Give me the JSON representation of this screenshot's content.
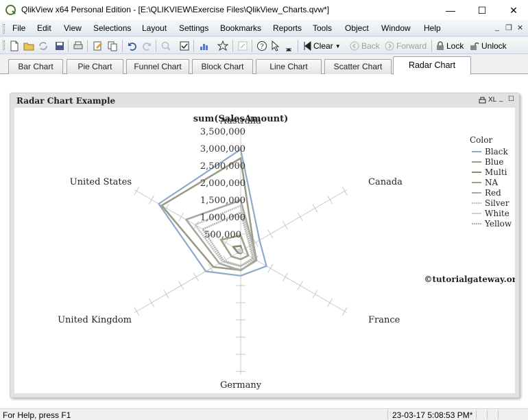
{
  "window": {
    "title": "QlikView x64 Personal Edition - [E:\\QLIKVIEW\\Exercise Files\\QlikView_Charts.qvw*]",
    "minimize": "—",
    "maximize": "☐",
    "close": "✕"
  },
  "menu": {
    "items": [
      "File",
      "Edit",
      "View",
      "Selections",
      "Layout",
      "Settings",
      "Bookmarks",
      "Reports",
      "Tools",
      "Object",
      "Window",
      "Help"
    ],
    "mdi_minimize": "_",
    "mdi_restore": "❐",
    "mdi_close": "✕"
  },
  "toolbar": {
    "clear": "Clear",
    "back": "Back",
    "forward": "Forward",
    "lock": "Lock",
    "unlock": "Unlock"
  },
  "tabs": [
    {
      "label": "Bar Chart",
      "active": false
    },
    {
      "label": "Pie Chart",
      "active": false
    },
    {
      "label": "Funnel Chart",
      "active": false
    },
    {
      "label": "Block Chart",
      "active": false
    },
    {
      "label": "Line Chart",
      "active": false
    },
    {
      "label": "Scatter Chart",
      "active": false
    },
    {
      "label": "Radar Chart",
      "active": true
    }
  ],
  "chart_object": {
    "caption": "Radar Chart Example",
    "caption_icons": {
      "print": "print-icon",
      "xl": "XL",
      "minimize": "_",
      "maximize": "☐"
    }
  },
  "chart_data": {
    "type": "radar",
    "title": "sum(SalesAmount)",
    "axes": [
      "Australia",
      "Canada",
      "France",
      "Germany",
      "United Kingdom",
      "United States"
    ],
    "radial_ticks": [
      "500,000",
      "1,000,000",
      "1,500,000",
      "2,000,000",
      "2,500,000",
      "3,000,000",
      "3,500,000"
    ],
    "rmax": 3500000,
    "legend_title": "Color",
    "legend_position": "right",
    "series": [
      {
        "name": "Black",
        "values": [
          2900000,
          620000,
          850000,
          700000,
          1150000,
          2700000
        ],
        "color": "#8ea8c8"
      },
      {
        "name": "Blue",
        "values": [
          2650000,
          420000,
          520000,
          540000,
          900000,
          2600000
        ],
        "color": "#9b9b85"
      },
      {
        "name": "Multi",
        "values": [
          150000,
          40000,
          50000,
          60000,
          90000,
          250000
        ],
        "color": "#8a8a70"
      },
      {
        "name": "NA",
        "values": [
          450000,
          160000,
          250000,
          230000,
          300000,
          650000
        ],
        "color": "#a1a18a"
      },
      {
        "name": "Red",
        "values": [
          1450000,
          400000,
          500000,
          550000,
          700000,
          1800000
        ],
        "color": "#a8a8a0"
      },
      {
        "name": "Silver",
        "values": [
          1300000,
          350000,
          450000,
          430000,
          600000,
          1500000
        ],
        "color": "#bcbcbc"
      },
      {
        "name": "White",
        "values": [
          60000,
          20000,
          30000,
          30000,
          40000,
          80000
        ],
        "color": "#cfcfcf"
      },
      {
        "name": "Yellow",
        "values": [
          1100000,
          300000,
          400000,
          420000,
          550000,
          1250000
        ],
        "color": "#b0b0a8"
      }
    ],
    "watermark": "©tutorialgateway.org"
  },
  "status": {
    "help": "For Help, press F1",
    "timestamp": "23-03-17 5:08:53 PM*"
  }
}
